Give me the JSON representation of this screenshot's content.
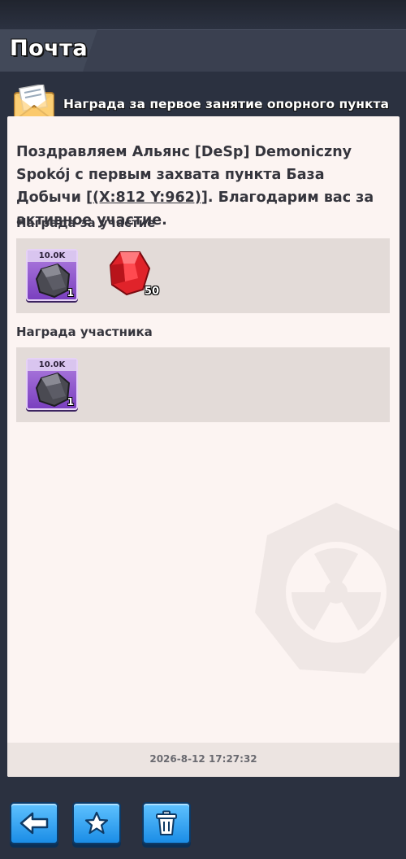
{
  "header": {
    "title": "Почта"
  },
  "mail": {
    "subject": "Награда за первое занятие опорного пункта",
    "message_before": "Поздравляем Альянс [DeSp] Demoniczny Spokój с первым захвата пункта База Добычи ",
    "coords_link": "[(X:812 Y:962)]",
    "message_after": ". Благодарим вас за активное участие.",
    "timestamp": "2026-8-12 17:27:32"
  },
  "sections": [
    {
      "label": "Награда за участие",
      "items": [
        {
          "icon": "ore-stone-icon",
          "banner": "10.0K",
          "count": "1"
        },
        {
          "icon": "red-gem-icon",
          "count": "50"
        }
      ]
    },
    {
      "label": "Награда участника",
      "items": [
        {
          "icon": "ore-stone-icon",
          "banner": "10.0K",
          "count": "1"
        }
      ]
    }
  ],
  "toolbar": {
    "back_icon": "back-arrow-icon",
    "favorite_icon": "star-icon",
    "delete_icon": "trash-icon"
  },
  "colors": {
    "panel_bg": "#fcf4f2",
    "reward_box_bg": "#e3dbd8",
    "button_blue": "#1b8de6",
    "item_purple": "#7a3fbf",
    "header_bg": "#3a4050"
  }
}
